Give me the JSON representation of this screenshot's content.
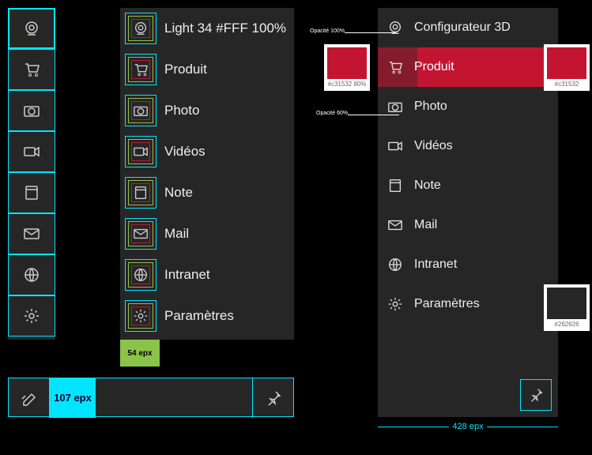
{
  "icons": [
    "cam",
    "cart",
    "camera",
    "video",
    "note",
    "mail",
    "globe",
    "gear"
  ],
  "items": [
    {
      "label": "Light 34 #FFF 100%",
      "icon": "cam"
    },
    {
      "label": "Produit",
      "icon": "cart"
    },
    {
      "label": "Photo",
      "icon": "camera"
    },
    {
      "label": "Vidéos",
      "icon": "video"
    },
    {
      "label": "Note",
      "icon": "note"
    },
    {
      "label": "Mail",
      "icon": "mail"
    },
    {
      "label": "Intranet",
      "icon": "globe"
    },
    {
      "label": "Paramètres",
      "icon": "gear"
    }
  ],
  "right_title": "Configurateur 3D",
  "right_selected": 1,
  "badge54": "54\nepx",
  "badge107": "107\nepx",
  "dim_width": "428\nepx",
  "swatches": [
    {
      "hex": "#c31532",
      "label": "#c31532 80%"
    },
    {
      "hex": "#c31532",
      "label": "#c31532"
    },
    {
      "hex": "#262626",
      "label": "#262626"
    }
  ],
  "anno1": "Opacité 100%",
  "anno2": "Opacité 60%"
}
